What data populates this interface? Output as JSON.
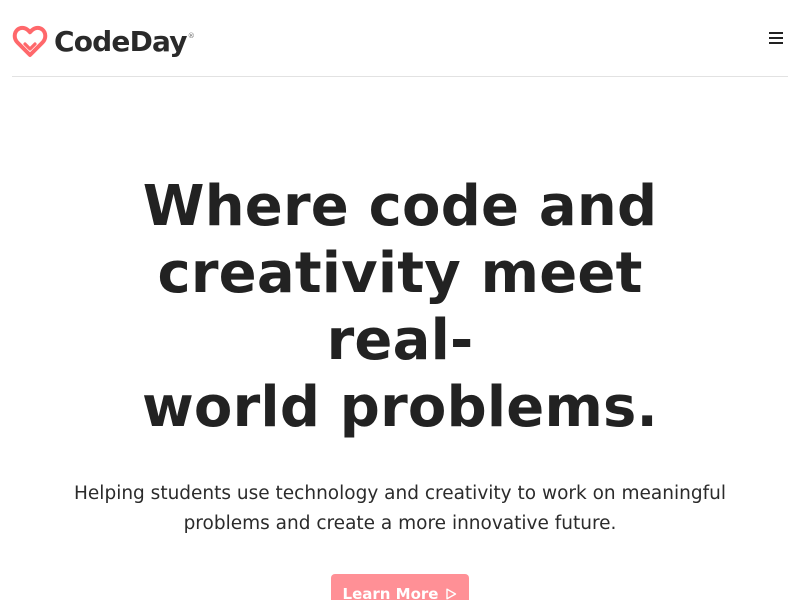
{
  "header": {
    "logo": {
      "text": "CodeDay",
      "registered_mark": "®",
      "icon": "heart-logo-icon",
      "icon_color": "#ff686b"
    },
    "menu_icon": "hamburger-menu-icon"
  },
  "hero": {
    "headline_lines": [
      "Where code and",
      "creativity meet real-",
      "world problems."
    ],
    "subtext_lines": [
      "Helping students use technology and creativity to work on meaningful",
      "problems and create a more innovative future."
    ],
    "cta": {
      "label": "Learn More",
      "icon": "play-triangle-icon",
      "background_color": "#ff9096",
      "text_color": "#ffffff"
    }
  },
  "colors": {
    "text": "#222222",
    "divider": "#e2e2e2",
    "background": "#ffffff"
  }
}
